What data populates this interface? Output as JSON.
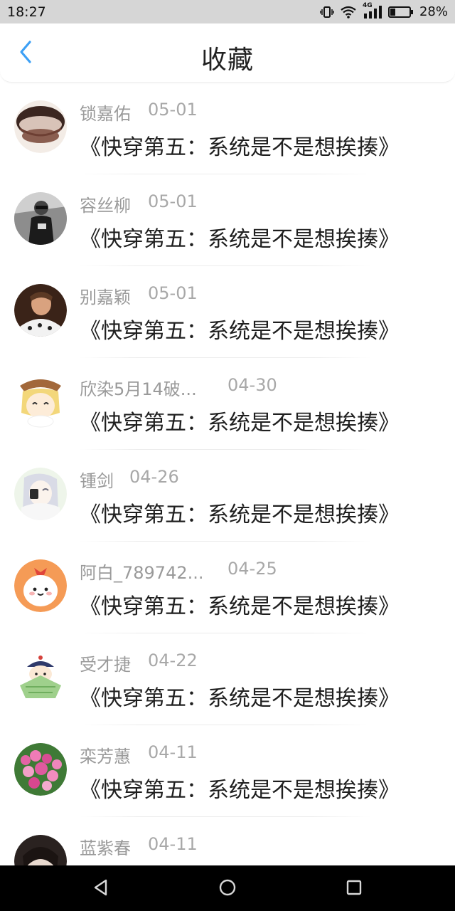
{
  "status_bar": {
    "time": "18:27",
    "network_label": "4G",
    "battery_percent": "28%",
    "battery_level": 0.28
  },
  "header": {
    "title": "收藏",
    "back_icon": "chevron-left-icon",
    "accent_color": "#3da0f5"
  },
  "favorites": [
    {
      "name": "锁嘉佑",
      "date": "05-01",
      "title": "《快穿第五：系统是不是想挨揍》"
    },
    {
      "name": "容丝柳",
      "date": "05-01",
      "title": "《快穿第五：系统是不是想挨揍》"
    },
    {
      "name": "别嘉颖",
      "date": "05-01",
      "title": "《快穿第五：系统是不是想挨揍》"
    },
    {
      "name": "欣染5月14破...",
      "date": "04-30",
      "title": "《快穿第五：系统是不是想挨揍》"
    },
    {
      "name": "锺剑",
      "date": "04-26",
      "title": "《快穿第五：系统是不是想挨揍》"
    },
    {
      "name": "阿白_789742...",
      "date": "04-25",
      "title": "《快穿第五：系统是不是想挨揍》"
    },
    {
      "name": "受才捷",
      "date": "04-22",
      "title": "《快穿第五：系统是不是想挨揍》"
    },
    {
      "name": "栾芳蕙",
      "date": "04-11",
      "title": "《快穿第五：系统是不是想挨揍》"
    },
    {
      "name": "蓝紫春",
      "date": "04-11",
      "title": ""
    }
  ],
  "nav": {
    "back_icon": "triangle-back-icon",
    "home_icon": "circle-home-icon",
    "recents_icon": "square-recents-icon"
  }
}
